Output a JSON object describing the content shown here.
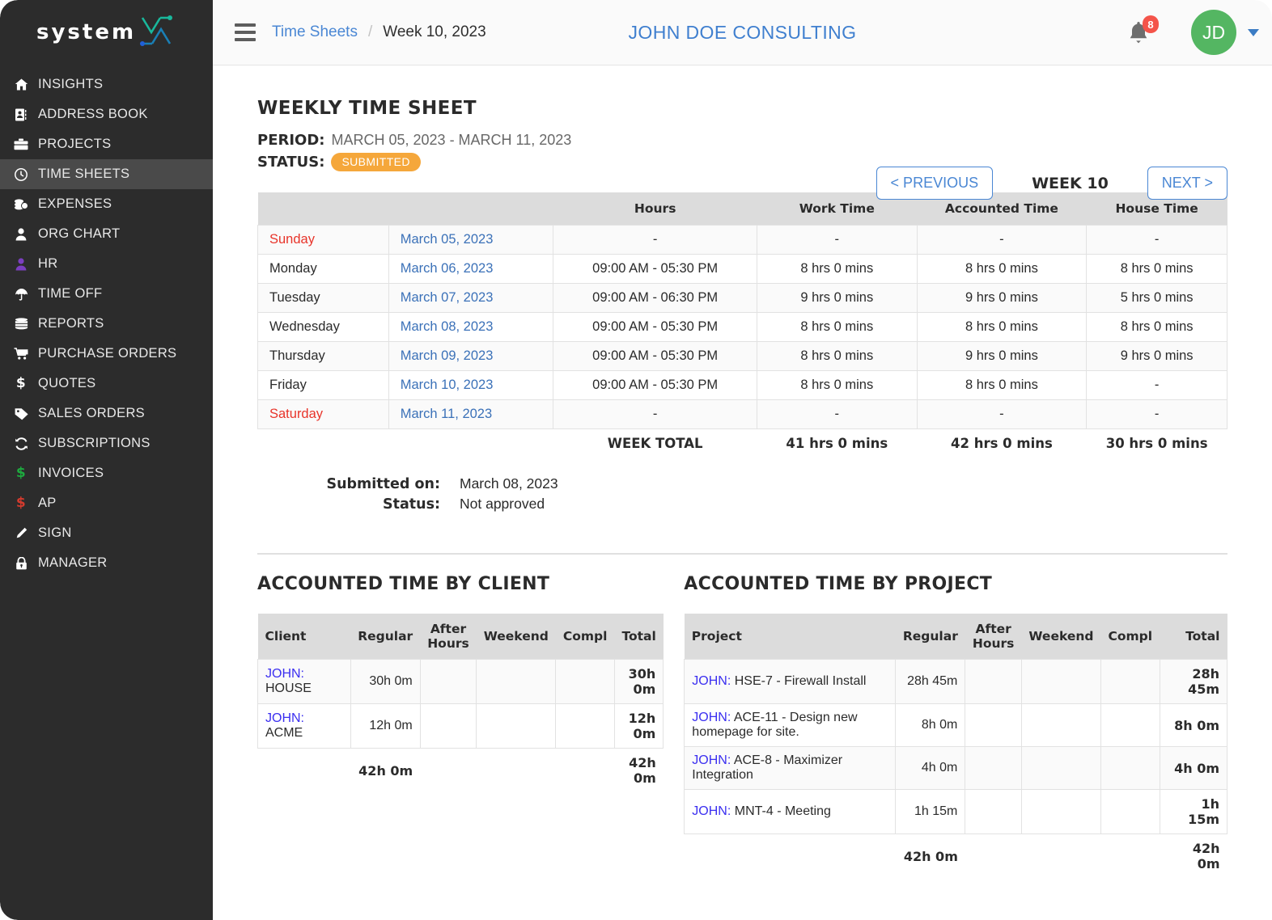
{
  "brand": {
    "word": "system",
    "mark_icon": "system-x-logo"
  },
  "colors": {
    "sidebar_bg": "#2c2c2c",
    "sidebar_active": "#4a4a4a",
    "accent_link": "#4a87d4",
    "status_submitted": "#f5a73b",
    "avatar": "#54b662",
    "badge": "#f4544a",
    "weekend_text": "#e8342a"
  },
  "sidebar": {
    "items": [
      {
        "label": "INSIGHTS",
        "icon": "home-icon",
        "active": false
      },
      {
        "label": "ADDRESS BOOK",
        "icon": "address-book-icon",
        "active": false
      },
      {
        "label": "PROJECTS",
        "icon": "briefcase-icon",
        "active": false
      },
      {
        "label": "TIME SHEETS",
        "icon": "clock-icon",
        "active": true
      },
      {
        "label": "EXPENSES",
        "icon": "coins-icon",
        "active": false
      },
      {
        "label": "ORG CHART",
        "icon": "user-icon",
        "active": false
      },
      {
        "label": "HR",
        "icon": "user-purple-icon",
        "active": false
      },
      {
        "label": "TIME OFF",
        "icon": "umbrella-icon",
        "active": false
      },
      {
        "label": "REPORTS",
        "icon": "database-icon",
        "active": false
      },
      {
        "label": "PURCHASE ORDERS",
        "icon": "cart-icon",
        "active": false
      },
      {
        "label": "QUOTES",
        "icon": "dollar-icon",
        "active": false
      },
      {
        "label": "SALES ORDERS",
        "icon": "tag-icon",
        "active": false
      },
      {
        "label": "SUBSCRIPTIONS",
        "icon": "refresh-icon",
        "active": false
      },
      {
        "label": "INVOICES",
        "icon": "dollar-green-icon",
        "active": false
      },
      {
        "label": "AP",
        "icon": "dollar-red-icon",
        "active": false
      },
      {
        "label": "SIGN",
        "icon": "pencil-icon",
        "active": false
      },
      {
        "label": "MANAGER",
        "icon": "lock-icon",
        "active": false
      }
    ]
  },
  "topbar": {
    "menu_icon": "hamburger-icon",
    "breadcrumb_link": "Time Sheets",
    "breadcrumb_sep": "/",
    "breadcrumb_current": "Week 10, 2023",
    "company": "JOHN DOE CONSULTING",
    "bell_icon": "bell-icon",
    "notification_count": "8",
    "avatar_initials": "JD",
    "caret_icon": "chevron-down-icon"
  },
  "page": {
    "title": "WEEKLY TIME SHEET",
    "period_label": "PERIOD:",
    "period_value": "MARCH 05, 2023 - MARCH 11, 2023",
    "status_label": "STATUS:",
    "status_value": "SUBMITTED"
  },
  "weeknav": {
    "previous": "< PREVIOUS",
    "week": "WEEK 10",
    "next": "NEXT >"
  },
  "timesheet": {
    "headers": [
      "",
      "",
      "Hours",
      "Work Time",
      "Accounted Time",
      "House Time"
    ],
    "rows": [
      {
        "day": "Sunday",
        "weekend": true,
        "date": "March 05, 2023",
        "hours": "-",
        "work": "-",
        "accounted": "-",
        "house": "-"
      },
      {
        "day": "Monday",
        "weekend": false,
        "date": "March 06, 2023",
        "hours": "09:00 AM - 05:30 PM",
        "work": "8 hrs  0 mins",
        "accounted": "8 hrs  0 mins",
        "house": "8 hrs  0 mins"
      },
      {
        "day": "Tuesday",
        "weekend": false,
        "date": "March 07, 2023",
        "hours": "09:00 AM - 06:30 PM",
        "work": "9 hrs  0 mins",
        "accounted": "9 hrs  0 mins",
        "house": "5 hrs  0 mins"
      },
      {
        "day": "Wednesday",
        "weekend": false,
        "date": "March 08, 2023",
        "hours": "09:00 AM - 05:30 PM",
        "work": "8 hrs  0 mins",
        "accounted": "8 hrs  0 mins",
        "house": "8 hrs  0 mins"
      },
      {
        "day": "Thursday",
        "weekend": false,
        "date": "March 09, 2023",
        "hours": "09:00 AM - 05:30 PM",
        "work": "8 hrs  0 mins",
        "accounted": "9 hrs  0 mins",
        "house": "9 hrs  0 mins"
      },
      {
        "day": "Friday",
        "weekend": false,
        "date": "March 10, 2023",
        "hours": "09:00 AM - 05:30 PM",
        "work": "8 hrs  0 mins",
        "accounted": "8 hrs  0 mins",
        "house": "-"
      },
      {
        "day": "Saturday",
        "weekend": true,
        "date": "March 11, 2023",
        "hours": "-",
        "work": "-",
        "accounted": "-",
        "house": "-"
      }
    ],
    "total": {
      "label": "WEEK TOTAL",
      "work": "41 hrs  0 mins",
      "accounted": "42 hrs  0 mins",
      "house": "30 hrs  0 mins"
    }
  },
  "submitted": {
    "on_label": "Submitted on:",
    "on_value": "March 08, 2023",
    "status_label": "Status:",
    "status_value": "Not approved"
  },
  "by_client": {
    "title": "ACCOUNTED TIME BY CLIENT",
    "headers": [
      "Client",
      "Regular",
      "After Hours",
      "Weekend",
      "Compl",
      "Total"
    ],
    "rows": [
      {
        "who": "JOHN:",
        "name": "HOUSE",
        "regular": "30h 0m",
        "after": "",
        "weekend": "",
        "compl": "",
        "total": "30h 0m"
      },
      {
        "who": "JOHN:",
        "name": "ACME",
        "regular": "12h 0m",
        "after": "",
        "weekend": "",
        "compl": "",
        "total": "12h 0m"
      }
    ],
    "totals": {
      "regular": "42h 0m",
      "total": "42h 0m"
    }
  },
  "by_project": {
    "title": "ACCOUNTED TIME BY PROJECT",
    "headers": [
      "Project",
      "Regular",
      "After Hours",
      "Weekend",
      "Compl",
      "Total"
    ],
    "rows": [
      {
        "who": "JOHN:",
        "name": "HSE-7 - Firewall Install",
        "regular": "28h 45m",
        "after": "",
        "weekend": "",
        "compl": "",
        "total": "28h 45m"
      },
      {
        "who": "JOHN:",
        "name": "ACE-11 - Design new homepage for site.",
        "regular": "8h 0m",
        "after": "",
        "weekend": "",
        "compl": "",
        "total": "8h 0m"
      },
      {
        "who": "JOHN:",
        "name": "ACE-8 - Maximizer Integration",
        "regular": "4h 0m",
        "after": "",
        "weekend": "",
        "compl": "",
        "total": "4h 0m"
      },
      {
        "who": "JOHN:",
        "name": "MNT-4 - Meeting",
        "regular": "1h 15m",
        "after": "",
        "weekend": "",
        "compl": "",
        "total": "1h 15m"
      }
    ],
    "totals": {
      "regular": "42h 0m",
      "total": "42h 0m"
    }
  }
}
